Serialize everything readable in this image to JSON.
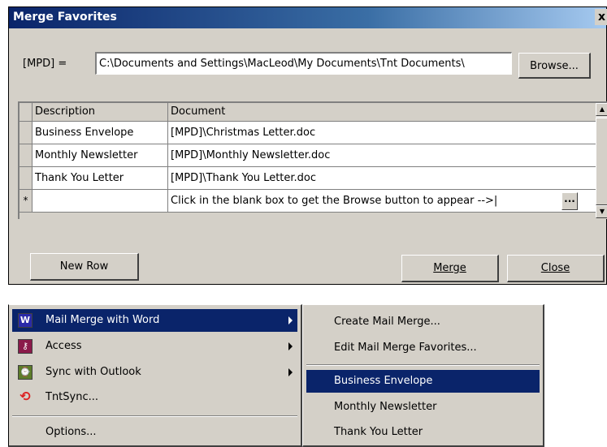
{
  "dialog": {
    "title": "Merge Favorites",
    "close_glyph": "x",
    "mpd_label": "[MPD] =",
    "mpd_value": "C:\\Documents and Settings\\MacLeod\\My Documents\\Tnt Documents\\",
    "browse_label": "Browse...",
    "grid": {
      "headers": [
        "Description",
        "Document"
      ],
      "rows": [
        {
          "description": "Business Envelope",
          "document": "[MPD]\\Christmas Letter.doc"
        },
        {
          "description": "Monthly Newsletter",
          "document": "[MPD]\\Monthly Newsletter.doc"
        },
        {
          "description": "Thank You Letter",
          "document": "[MPD]\\Thank You Letter.doc"
        }
      ],
      "new_row_marker": "*",
      "new_row_document": "Click in the blank box to get the Browse button to appear -->|",
      "ellipsis": "..."
    },
    "new_row_label": "New Row",
    "merge_label": "Merge",
    "close_label": "Close"
  },
  "menu": {
    "items": [
      {
        "label": "Mail Merge with Word",
        "icon": "word-icon",
        "icon_char": "W",
        "icon_color": "#2a2aa8",
        "submenu": true,
        "highlighted": true
      },
      {
        "label": "Access",
        "icon": "access-key-icon",
        "icon_char": "⚷",
        "icon_color": "#8b1a4a",
        "submenu": true
      },
      {
        "label": "Sync with Outlook",
        "icon": "sync-outlook-icon",
        "icon_char": "⌚",
        "icon_color": "#5d7d2a",
        "submenu": true
      },
      {
        "label": "TntSync...",
        "icon": "tntsync-icon",
        "icon_char": "⟲",
        "icon_color": "#d4d0c8",
        "submenu": false
      }
    ],
    "options_label": "Options..."
  },
  "submenu": {
    "create_label": "Create Mail Merge...",
    "edit_label": "Edit Mail Merge Favorites...",
    "favorites": [
      "Business Envelope",
      "Monthly Newsletter",
      "Thank You Letter"
    ]
  },
  "colors": {
    "titlebar": "#0a246a",
    "highlight": "#0a246a",
    "face": "#d4d0c8"
  }
}
